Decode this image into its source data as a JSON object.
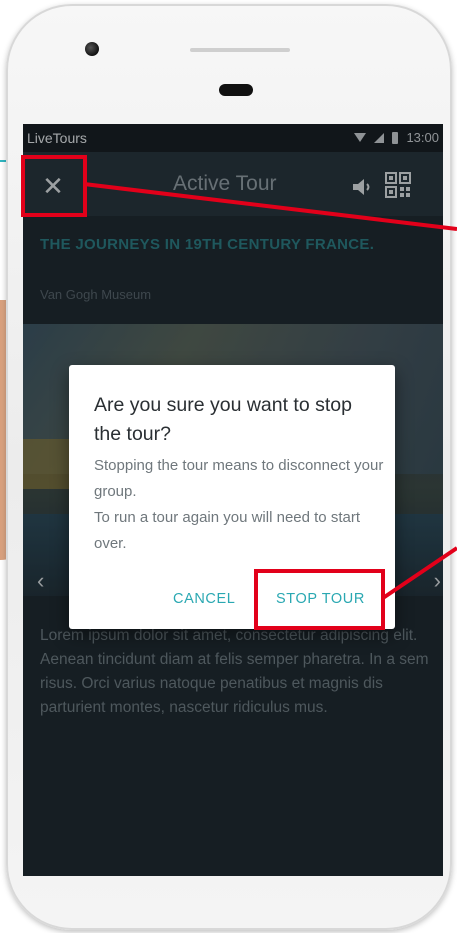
{
  "status_bar": {
    "app_name": "LiveTours",
    "time": "13:00"
  },
  "app_bar": {
    "title": "Active Tour",
    "close_glyph": "✕",
    "icons": [
      "close-icon",
      "volume-icon",
      "qr-code-icon"
    ]
  },
  "tour": {
    "title": "THE JOURNEYS IN 19TH CENTURY FRANCE.",
    "museum": "Van Gogh Museum",
    "description": "Lorem ipsum dolor sit amet, consectetur adipiscing elit. Aenean tincidunt diam at felis semper pharetra. In a sem risus. Orci varius natoque penatibus et magnis dis parturient montes, nascetur ridiculus mus."
  },
  "carousel": {
    "prev_glyph": "‹",
    "next_glyph": "›"
  },
  "dialog": {
    "title": "Are you sure you want to stop the tour?",
    "body_line1": "Stopping the tour means to disconnect your group.",
    "body_line2": "To run a tour again you will need to start over.",
    "cancel_label": "CANCEL",
    "stop_label": "STOP TOUR"
  },
  "colors": {
    "accent": "#2aa8b2",
    "highlight": "#e2001a",
    "screen_bg": "#1f2a31",
    "app_bar": "#28353d"
  }
}
